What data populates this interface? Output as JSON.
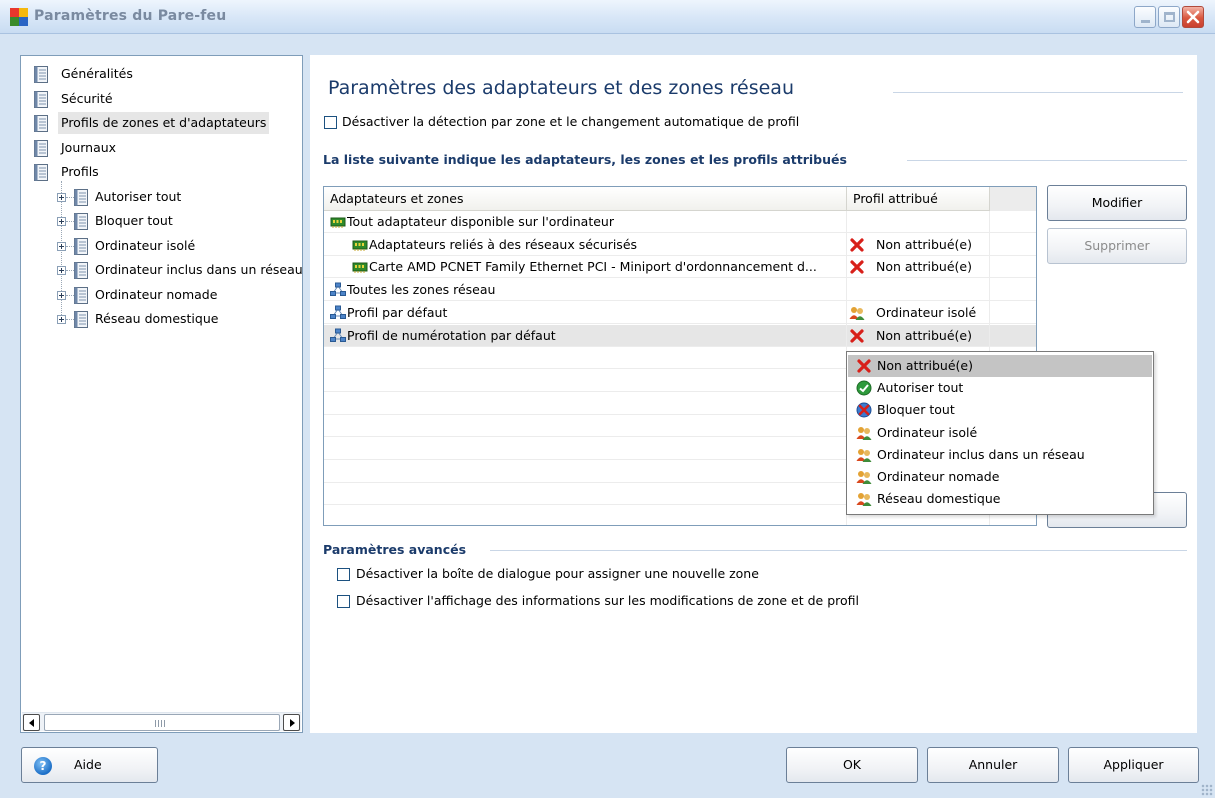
{
  "window": {
    "title": "Paramètres du Pare-feu"
  },
  "sidebar": {
    "items": [
      {
        "label": "Généralités",
        "level": 0,
        "selected": false
      },
      {
        "label": "Sécurité",
        "level": 0,
        "selected": false
      },
      {
        "label": "Profils de zones et d'adaptateurs",
        "level": 0,
        "selected": true
      },
      {
        "label": "Journaux",
        "level": 0,
        "selected": false
      },
      {
        "label": "Profils",
        "level": 0,
        "selected": false
      },
      {
        "label": "Autoriser tout",
        "level": 1,
        "selected": false
      },
      {
        "label": "Bloquer tout",
        "level": 1,
        "selected": false
      },
      {
        "label": "Ordinateur isolé",
        "level": 1,
        "selected": false
      },
      {
        "label": "Ordinateur inclus dans un réseau",
        "level": 1,
        "selected": false
      },
      {
        "label": "Ordinateur nomade",
        "level": 1,
        "selected": false
      },
      {
        "label": "Réseau domestique",
        "level": 1,
        "selected": false
      }
    ],
    "scroll_grip": "III"
  },
  "main": {
    "title": "Paramètres des adaptateurs et des zones réseau",
    "disable_detection_label": "Désactiver la détection par zone et le changement automatique de profil",
    "list_section_title": "La liste suivante indique les adaptateurs, les zones et les profils attribués",
    "list": {
      "columns": [
        "Adaptateurs et zones",
        "Profil attribué"
      ],
      "rows": [
        {
          "name": "Tout adaptateur disponible sur l'ordinateur",
          "icon": "network-adapter-icon",
          "indent": 0,
          "profile": "",
          "profile_icon": ""
        },
        {
          "name": "Adaptateurs reliés à des réseaux sécurisés",
          "icon": "network-adapter-icon",
          "indent": 1,
          "profile": "Non attribué(e)",
          "profile_icon": "red-x-icon"
        },
        {
          "name": "Carte AMD PCNET Family Ethernet PCI - Miniport d'ordonnancement d...",
          "icon": "network-adapter-icon",
          "indent": 1,
          "profile": "Non attribué(e)",
          "profile_icon": "red-x-icon"
        },
        {
          "name": "Toutes les zones réseau",
          "icon": "network-zone-icon",
          "indent": 0,
          "profile": "",
          "profile_icon": ""
        },
        {
          "name": "Profil par défaut",
          "icon": "network-zone-icon",
          "indent": 0,
          "profile": "Ordinateur isolé",
          "profile_icon": "users-icon"
        },
        {
          "name": "Profil de numérotation par défaut",
          "icon": "network-zone-icon",
          "indent": 0,
          "profile": "Non attribué(e)",
          "profile_icon": "red-x-icon",
          "selected": true
        }
      ]
    },
    "buttons": {
      "modify": "Modifier",
      "delete": "Supprimer"
    },
    "dropdown": {
      "options": [
        {
          "label": "Non attribué(e)",
          "icon": "red-x-icon",
          "highlighted": true
        },
        {
          "label": "Autoriser tout",
          "icon": "green-check-icon",
          "highlighted": false
        },
        {
          "label": "Bloquer tout",
          "icon": "block-icon",
          "highlighted": false
        },
        {
          "label": "Ordinateur isolé",
          "icon": "users-icon",
          "highlighted": false
        },
        {
          "label": "Ordinateur inclus dans un réseau",
          "icon": "users-icon",
          "highlighted": false
        },
        {
          "label": "Ordinateur nomade",
          "icon": "users-icon",
          "highlighted": false
        },
        {
          "label": "Réseau domestique",
          "icon": "users-icon",
          "highlighted": false
        }
      ]
    },
    "advanced": {
      "title": "Paramètres avancés",
      "option1": "Désactiver la boîte de dialogue pour assigner une nouvelle zone",
      "option2": "Désactiver l'affichage des informations sur les modifications de zone et de profil"
    }
  },
  "footer": {
    "help": "Aide",
    "ok": "OK",
    "cancel": "Annuler",
    "apply": "Appliquer"
  },
  "colors": {
    "accent_title": "#1b3b6b",
    "window_bg": "#d6e4f3",
    "selection": "#e6e6e6",
    "dropdown_highlight": "#c4c4c4",
    "error_red": "#d8201a"
  }
}
